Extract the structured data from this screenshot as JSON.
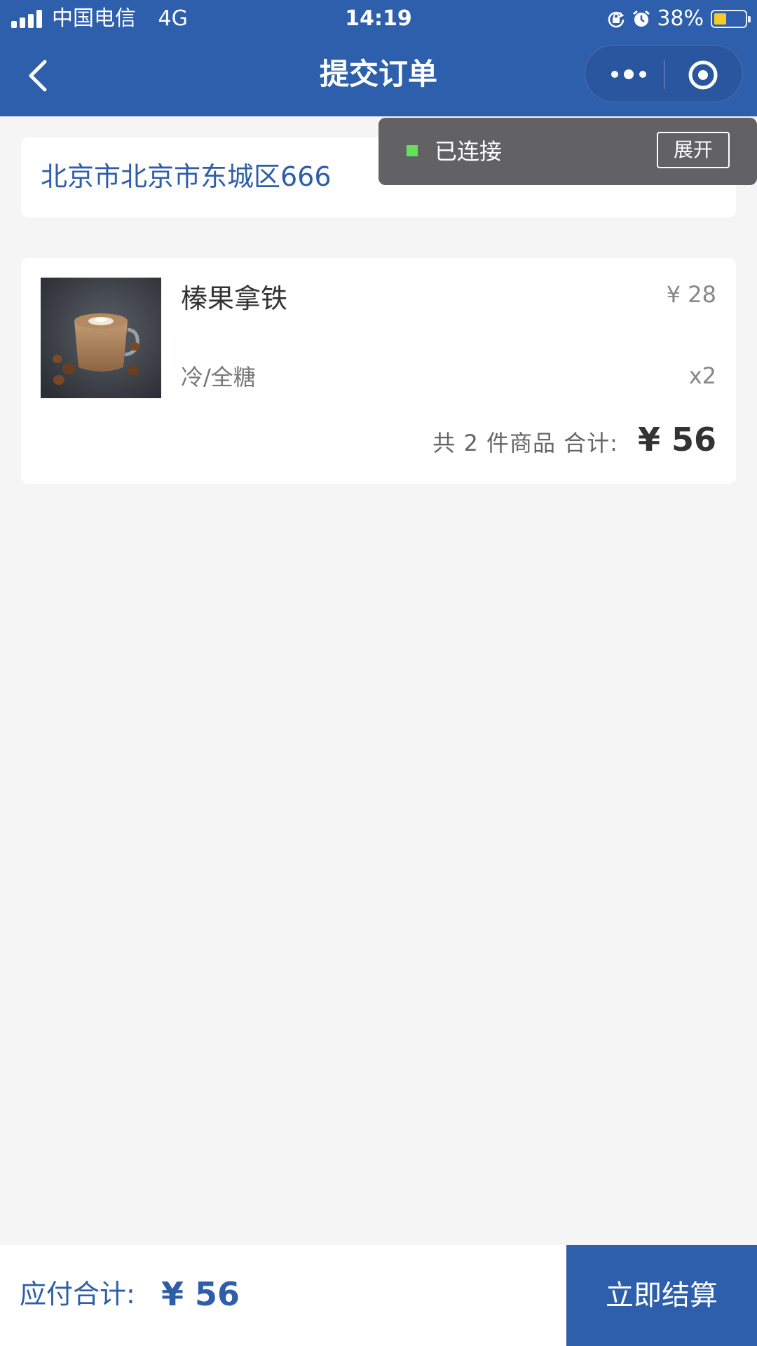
{
  "status_bar": {
    "carrier": "中国电信",
    "network": "4G",
    "time": "14:19",
    "battery_percent": "38%",
    "battery_level": 0.38,
    "icons": [
      "signal-icon",
      "rotation-lock-icon",
      "alarm-icon",
      "battery-icon"
    ]
  },
  "nav": {
    "title": "提交订单",
    "icons": [
      "back-chevron-icon",
      "more-dots-icon",
      "close-circle-icon"
    ]
  },
  "connection": {
    "status": "已连接",
    "expand_label": "展开",
    "dot_color": "#63e15a"
  },
  "address": {
    "text": "北京市北京市东城区666"
  },
  "order": {
    "item": {
      "name": "榛果拿铁",
      "spec": "冷/全糖",
      "price": "¥ 28",
      "quantity": "x2",
      "image_icon": "latte-cup-image"
    },
    "summary_count": "共 2 件商品 合计:",
    "summary_total": "¥ 56"
  },
  "bottom_bar": {
    "pay_label": "应付合计:",
    "pay_amount": "¥ 56",
    "checkout_label": "立即结算"
  },
  "colors": {
    "brand_blue": "#2d5fac",
    "text_blue": "#2e5ea8",
    "background": "#f5f5f5",
    "toast_bg": "#5a5a5c",
    "battery_fill": "#f5cb2b"
  }
}
